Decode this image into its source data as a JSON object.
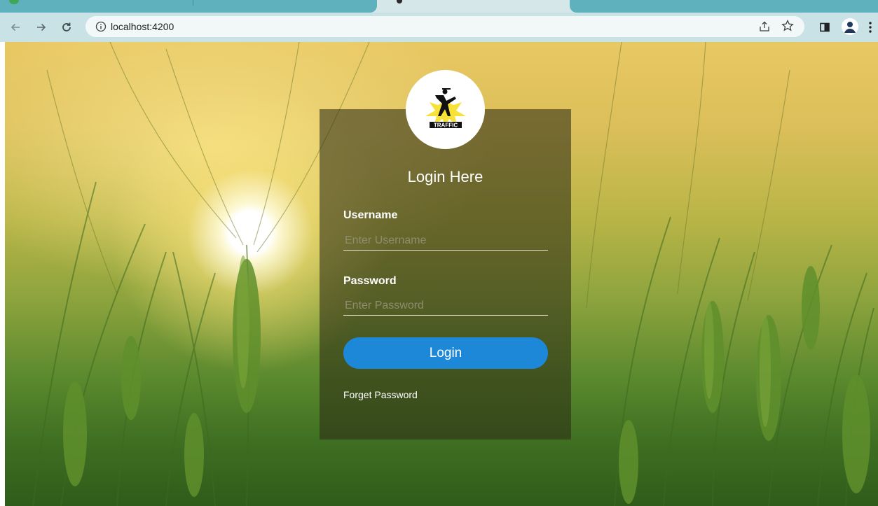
{
  "browser": {
    "url": "localhost:4200",
    "theme_color": "#5fb1bd",
    "icons": {
      "back": "arrow-left-icon",
      "forward": "arrow-right-icon",
      "reload": "reload-icon",
      "site_info": "info-icon",
      "share": "share-icon",
      "bookmark": "star-icon",
      "side_panel": "side-panel-icon",
      "profile": "avatar-icon",
      "menu": "kebab-menu-icon"
    }
  },
  "login": {
    "logo_text": "TRAFFIC",
    "title": "Login Here",
    "username_label": "Username",
    "username_placeholder": "Enter Username",
    "password_label": "Password",
    "password_placeholder": "Enter Password",
    "login_button": "Login",
    "forget_password": "Forget Password",
    "button_color": "#1e88d8"
  }
}
